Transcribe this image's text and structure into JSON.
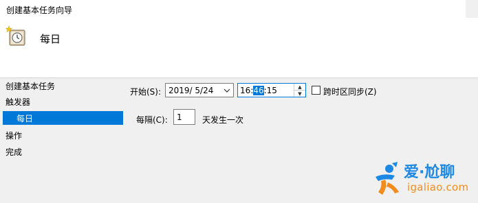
{
  "window": {
    "title": "创建基本任务向导"
  },
  "header": {
    "page_title": "每日"
  },
  "nav": {
    "items": [
      {
        "label": "创建基本任务"
      },
      {
        "label": "触发器"
      },
      {
        "label": "每日"
      },
      {
        "label": "操作"
      },
      {
        "label": "完成"
      }
    ],
    "selected_index": 2
  },
  "form": {
    "start_label": "开始(S):",
    "start_date": "2019/ 5/24",
    "start_time": {
      "hour": "16",
      "sep1": ":",
      "minute": "46",
      "sep2": ":",
      "second": "15"
    },
    "selected_time_field": "minute",
    "sync_label": "跨时区同步(Z)",
    "sync_checked": false,
    "recur_label": "每隔(C):",
    "recur_value": "1",
    "recur_suffix": "天发生一次"
  },
  "watermark": {
    "brand": "爱·尬聊",
    "url": "igaliao.com"
  },
  "colors": {
    "accent": "#0078d7",
    "watermark_blue": "#1e88e5",
    "watermark_orange": "#f28c1c"
  },
  "icons": {
    "header": "scheduled-task-clock-icon",
    "date_dropdown": "chevron-down-icon",
    "spin_up": "spin-up-icon",
    "spin_down": "spin-down-icon"
  }
}
